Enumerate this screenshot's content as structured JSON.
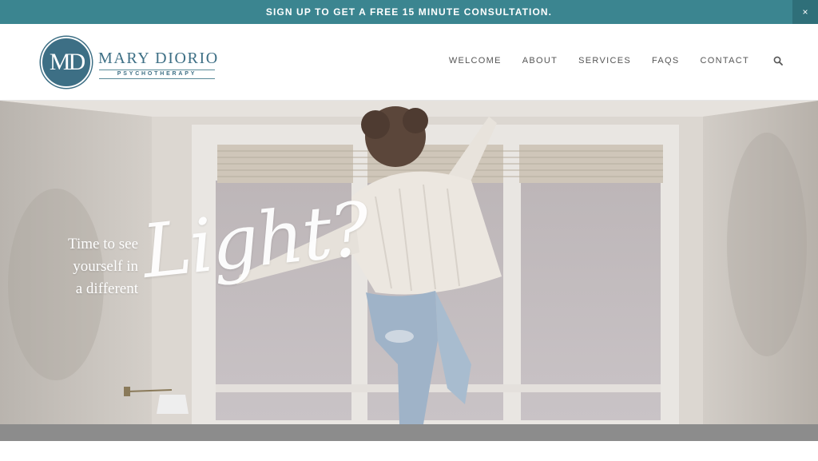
{
  "promo": {
    "text": "SIGN UP TO GET A FREE 15 MINUTE CONSULTATION.",
    "close": "×"
  },
  "brand": {
    "initials": "MD",
    "name": "MARY DIORIO",
    "subtitle": "PSYCHOTHERAPY"
  },
  "nav": {
    "items": [
      "WELCOME",
      "ABOUT",
      "SERVICES",
      "FAQS",
      "CONTACT"
    ],
    "search_icon": "search-icon"
  },
  "hero": {
    "line1": "Time to see",
    "line2": "yourself in",
    "line3": "a different",
    "script": "Light?"
  },
  "colors": {
    "promo_bg": "#3b8590",
    "brand": "#3d6f85",
    "nav_text": "#555555"
  }
}
